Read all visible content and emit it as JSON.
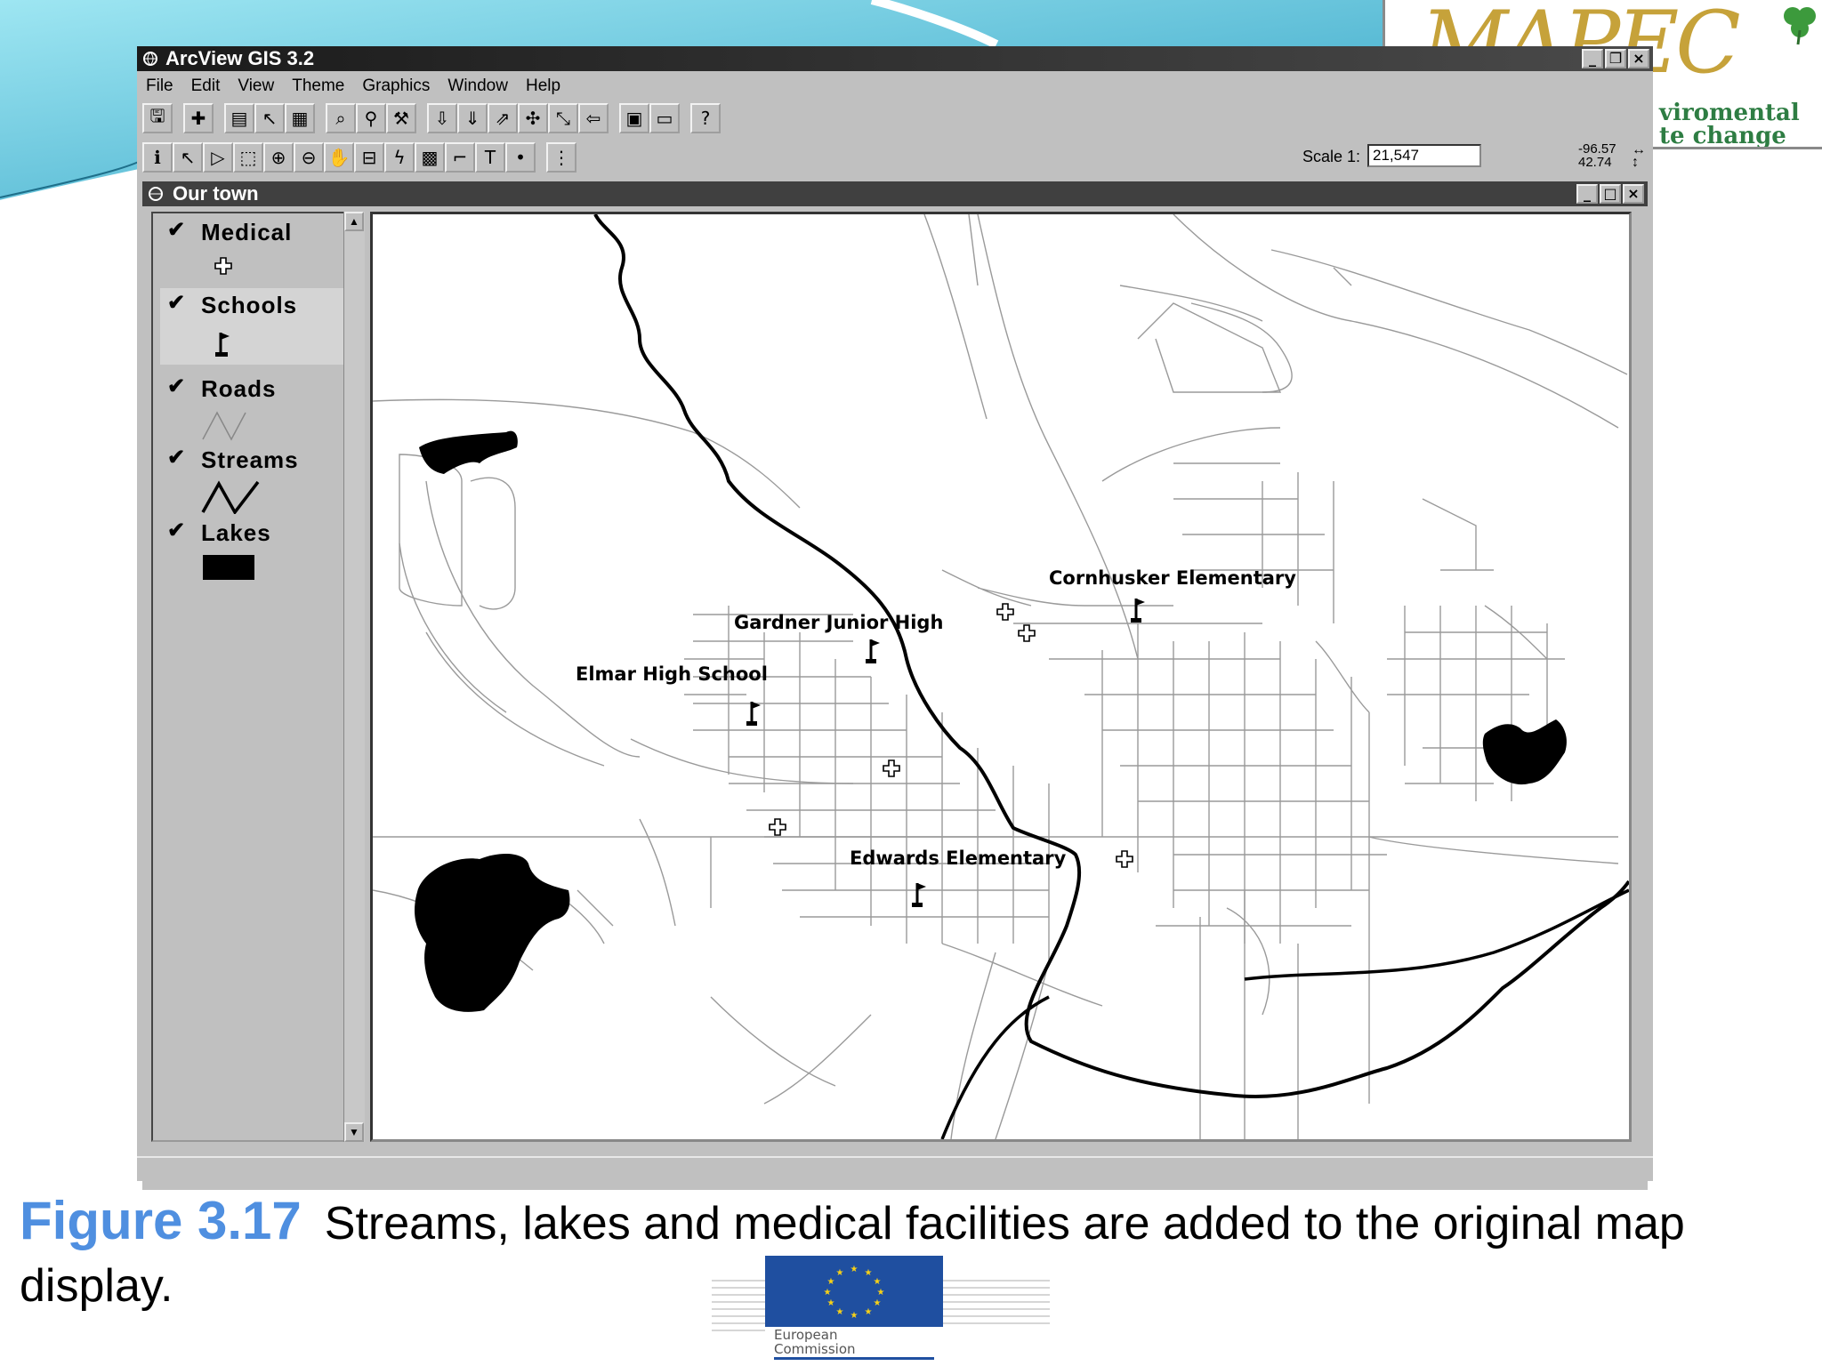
{
  "app": {
    "title": "ArcView GIS 3.2",
    "menu": [
      "File",
      "Edit",
      "View",
      "Theme",
      "Graphics",
      "Window",
      "Help"
    ],
    "scale_label": "Scale 1:",
    "scale_value": "21,547",
    "coord_x": "-96.57",
    "coord_y": "42.74"
  },
  "view": {
    "title": "Our town",
    "legend": [
      {
        "label": "Medical",
        "symbol": "cross-icon"
      },
      {
        "label": "Schools",
        "symbol": "flag-icon"
      },
      {
        "label": "Roads",
        "symbol": "thin-line-icon"
      },
      {
        "label": "Streams",
        "symbol": "thick-line-icon"
      },
      {
        "label": "Lakes",
        "symbol": "filled-rect-icon"
      }
    ],
    "map_labels": {
      "cornhusker": "Cornhusker Elementary",
      "gardner": "Gardner Junior High",
      "elmar": "Elmar High School",
      "edwards": "Edwards Elementary"
    }
  },
  "slide": {
    "figure_number": "Figure 3.17",
    "caption": "Streams, lakes and medical facilities are added to the original map display.",
    "logo_line1": "viromental",
    "logo_line2": "te change",
    "ec_line1": "European",
    "ec_line2": "Commission"
  }
}
